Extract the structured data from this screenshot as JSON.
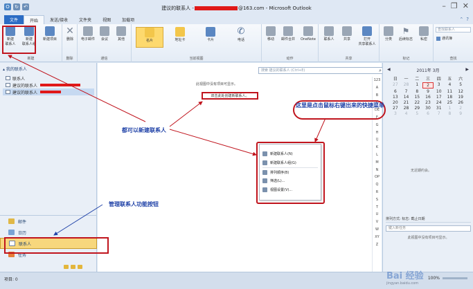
{
  "window": {
    "title_prefix": "建议的联系人 -",
    "title_suffix": "@163.com - Microsoft Outlook"
  },
  "tabs": [
    {
      "label": "文件"
    },
    {
      "label": "开始"
    },
    {
      "label": "发送/接收"
    },
    {
      "label": "文件夹"
    },
    {
      "label": "视图"
    },
    {
      "label": "加载项"
    }
  ],
  "ribbon": {
    "groups": {
      "new": {
        "label": "新建",
        "buttons": [
          "新建\n联系人",
          "新建\n联系人组",
          "新建项目"
        ]
      },
      "delete": {
        "label": "删除",
        "buttons": [
          "删除"
        ]
      },
      "communicate": {
        "label": "通信",
        "buttons": [
          "电子邮件",
          "会议",
          "其他"
        ]
      },
      "current_view": {
        "label": "当前视图",
        "buttons": [
          "名片",
          "地址卡",
          "卡片",
          "电话"
        ]
      },
      "actions": {
        "label": "动作",
        "buttons": [
          "移动",
          "邮件合并",
          "OneNote"
        ]
      },
      "share": {
        "label": "共享",
        "buttons": [
          "联系人",
          "共享",
          "打开\n共享联系人"
        ]
      },
      "tags": {
        "label": "标记",
        "buttons": [
          "分类",
          "后续标志",
          "私密"
        ]
      },
      "find": {
        "label": "查找",
        "search_placeholder": "查找联系人",
        "address_book": "通讯簿"
      }
    }
  },
  "folder_tree": {
    "header": "我的联系人",
    "items": [
      "联系人",
      "建议的联系人",
      "建议的联系人"
    ]
  },
  "nav_pane": {
    "items": [
      {
        "label": "邮件",
        "icon": "mail-icon"
      },
      {
        "label": "日历",
        "icon": "calendar-icon"
      },
      {
        "label": "联系人",
        "icon": "contacts-icon"
      },
      {
        "label": "任务",
        "icon": "tasks-icon"
      }
    ]
  },
  "center": {
    "search_placeholder": "搜索 建议的联系人 (Ctrl+E)",
    "empty_message": "此视图中没有项目可显示。",
    "create_link": "双击此处创建新联系人。",
    "alphabet": [
      "123",
      "A",
      "B",
      "C",
      "DE",
      "F",
      "G",
      "H",
      "IJ",
      "K",
      "L",
      "M",
      "N",
      "OP",
      "Q",
      "R",
      "S",
      "T",
      "U",
      "V",
      "W",
      "XY",
      "Z"
    ]
  },
  "context_menu": {
    "items": [
      "新建联系人(N)",
      "新建联系人组(G)",
      "排列顺序(B)",
      "筛选(L)...",
      "视图设置(V)..."
    ]
  },
  "todo_bar": {
    "month_label": "2011年 3月",
    "weekdays": [
      "日",
      "一",
      "二",
      "三",
      "四",
      "五",
      "六"
    ],
    "days": [
      [
        "27",
        "28",
        "1",
        "2",
        "3",
        "4",
        "5"
      ],
      [
        "6",
        "7",
        "8",
        "9",
        "10",
        "11",
        "12"
      ],
      [
        "13",
        "14",
        "15",
        "16",
        "17",
        "18",
        "19"
      ],
      [
        "20",
        "21",
        "22",
        "23",
        "24",
        "25",
        "26"
      ],
      [
        "27",
        "28",
        "29",
        "30",
        "31",
        "1",
        "2"
      ],
      [
        "3",
        "4",
        "5",
        "6",
        "7",
        "8",
        "9"
      ]
    ],
    "no_appointments": "无近期约会。",
    "task_header": "排列方式: 标志: 截止日期",
    "task_input": "键入新任务",
    "task_empty": "此视图中没有项目可显示。"
  },
  "status": {
    "items": "项目: 0",
    "zoom": "100%"
  },
  "annotations": {
    "new_contact": "都可以新建联系人",
    "right_click": "这里是点击鼠标右键出来的快捷菜单",
    "manage": "管理联系人功能按钮"
  },
  "watermark": {
    "text": "Bai 经验",
    "sub": "jingyan.baidu.com"
  },
  "colors": {
    "accent": "#2b6cc4",
    "annotation_red": "#c0141d",
    "annotation_blue": "#2143a8"
  }
}
